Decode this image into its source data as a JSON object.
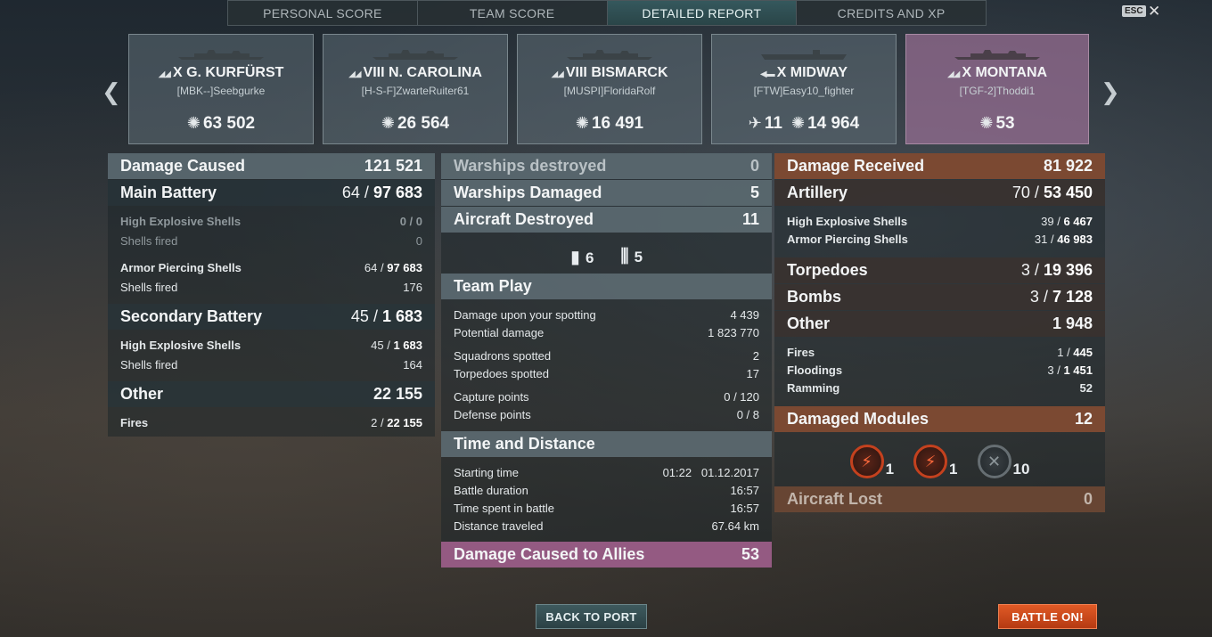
{
  "tabs": [
    "PERSONAL SCORE",
    "TEAM SCORE",
    "DETAILED REPORT",
    "CREDITS AND XP"
  ],
  "esc_label": "ESC",
  "close_glyph": "✕",
  "ships": [
    {
      "tier": "X",
      "name": "G. KURFÜRST",
      "player": "[MBK--]Seebgurke",
      "damage": "63 502",
      "planes": ""
    },
    {
      "tier": "VIII",
      "name": "N. CAROLINA",
      "player": "[H-S-F]ZwarteRuiter61",
      "damage": "26 564",
      "planes": ""
    },
    {
      "tier": "VIII",
      "name": "BISMARCK",
      "player": "[MUSPI]FloridaRolf",
      "damage": "16 491",
      "planes": ""
    },
    {
      "tier": "X",
      "name": "MIDWAY",
      "player": "[FTW]Easy10_fighter",
      "damage": "14 964",
      "planes": "11"
    },
    {
      "tier": "X",
      "name": "MONTANA",
      "player": "[TGF-2]Thoddi1",
      "damage": "53",
      "planes": ""
    }
  ],
  "damage_caused": {
    "title": "Damage Caused",
    "total": "121 521",
    "main_battery": {
      "label": "Main Battery",
      "hits": "64",
      "dmg": "97 683"
    },
    "he_label": "High Explosive Shells",
    "he_hits": "0",
    "he_dmg": "0",
    "he_fired_label": "Shells fired",
    "he_fired": "0",
    "ap_label": "Armor Piercing Shells",
    "ap_hits": "64",
    "ap_dmg": "97 683",
    "ap_fired_label": "Shells fired",
    "ap_fired": "176",
    "secondary": {
      "label": "Secondary Battery",
      "hits": "45",
      "dmg": "1 683"
    },
    "sec_he_label": "High Explosive Shells",
    "sec_he_hits": "45",
    "sec_he_dmg": "1 683",
    "sec_fired_label": "Shells fired",
    "sec_fired": "164",
    "other_label": "Other",
    "other_total": "22 155",
    "fires_label": "Fires",
    "fires_hits": "2",
    "fires_dmg": "22 155"
  },
  "center": {
    "warships_destroyed_label": "Warships destroyed",
    "warships_destroyed": "0",
    "warships_damaged_label": "Warships Damaged",
    "warships_damaged": "5",
    "aircraft_destroyed_label": "Aircraft Destroyed",
    "aircraft_destroyed": "11",
    "icon_a_count": "6",
    "icon_b_count": "5",
    "team_play_title": "Team Play",
    "spotting_label": "Damage upon your spotting",
    "spotting": "4 439",
    "potential_label": "Potential damage",
    "potential": "1 823 770",
    "squadrons_label": "Squadrons spotted",
    "squadrons": "2",
    "torpedoes_label": "Torpedoes spotted",
    "torpedoes": "17",
    "capture_label": "Capture points",
    "capture": "0 / 120",
    "defense_label": "Defense points",
    "defense": "0 / 8",
    "time_title": "Time and Distance",
    "start_label": "Starting time",
    "start": "01:22   01.12.2017",
    "duration_label": "Battle duration",
    "duration": "16:57",
    "spent_label": "Time spent in battle",
    "spent": "16:57",
    "distance_label": "Distance traveled",
    "distance": "67.64 km",
    "allies_label": "Damage Caused to Allies",
    "allies": "53"
  },
  "received": {
    "title": "Damage Received",
    "total": "81 922",
    "artillery_label": "Artillery",
    "artillery_hits": "70",
    "artillery_dmg": "53 450",
    "he_label": "High Explosive Shells",
    "he_hits": "39",
    "he_dmg": "6 467",
    "ap_label": "Armor Piercing Shells",
    "ap_hits": "31",
    "ap_dmg": "46 983",
    "torp_label": "Torpedoes",
    "torp_hits": "3",
    "torp_dmg": "19 396",
    "bombs_label": "Bombs",
    "bombs_hits": "3",
    "bombs_dmg": "7 128",
    "other_label": "Other",
    "other_total": "1 948",
    "fires_label": "Fires",
    "fires_hits": "1",
    "fires_dmg": "445",
    "flood_label": "Floodings",
    "flood_hits": "3",
    "flood_dmg": "1 451",
    "ram_label": "Ramming",
    "ram": "52",
    "modules_label": "Damaged Modules",
    "modules": "12",
    "mod_counts": [
      "1",
      "1",
      "10"
    ],
    "aircraft_lost_label": "Aircraft Lost",
    "aircraft_lost": "0"
  },
  "buttons": {
    "back": "BACK TO PORT",
    "battle": "BATTLE ON!"
  }
}
